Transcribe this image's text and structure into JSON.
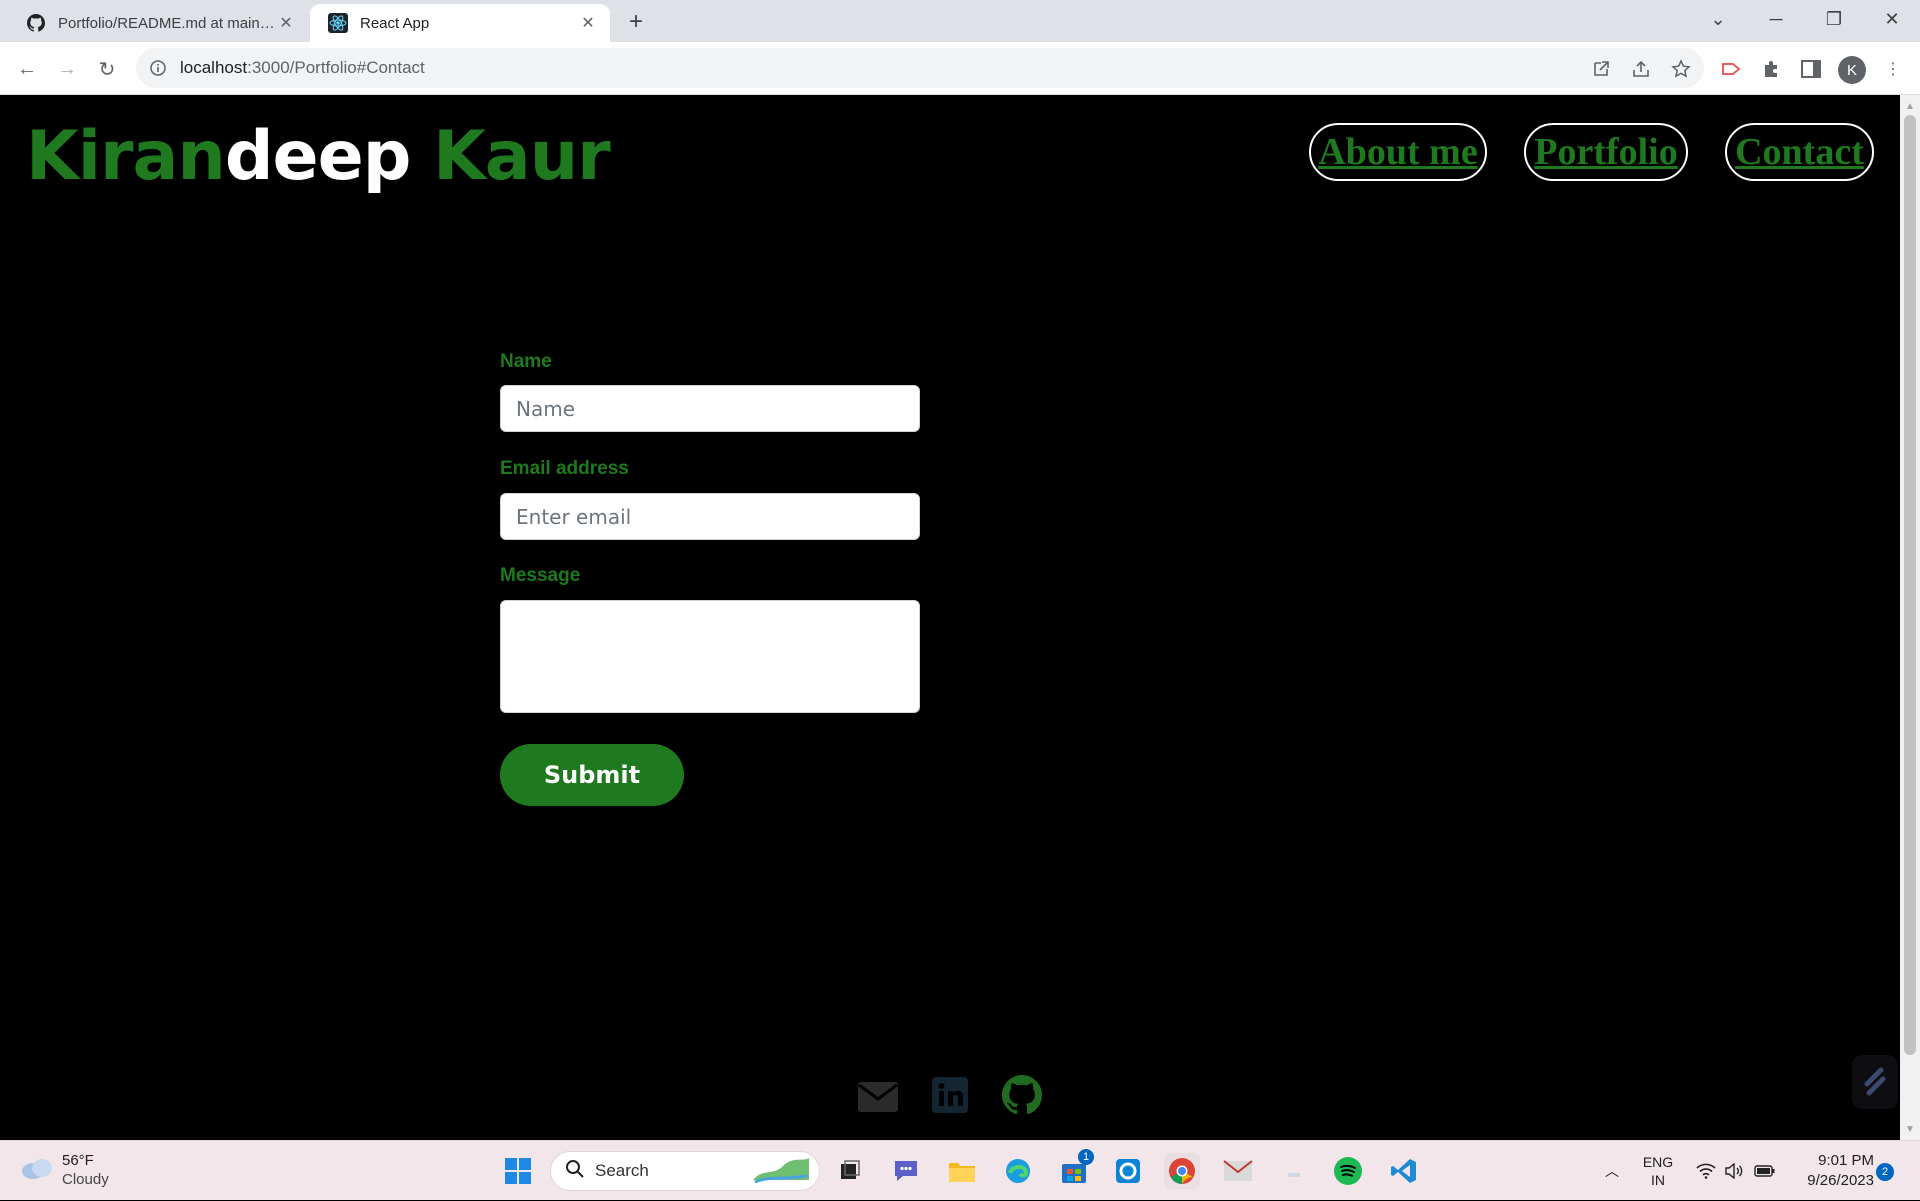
{
  "browser": {
    "tabs": [
      {
        "title": "Portfolio/README.md at main · N",
        "icon": "github-icon",
        "active": false
      },
      {
        "title": "React App",
        "icon": "react-icon",
        "active": true
      }
    ],
    "url_host": "localhost",
    "url_rest": ":3000/Portfolio#Contact",
    "avatar_initial": "K"
  },
  "page": {
    "brand": {
      "part1": "Kiran",
      "part2": "deep",
      "part3": " Kaur"
    },
    "nav": [
      {
        "label": "About me"
      },
      {
        "label": "Portfolio"
      },
      {
        "label": "Contact"
      }
    ],
    "form": {
      "name_label": "Name",
      "name_placeholder": "Name",
      "email_label": "Email address",
      "email_placeholder": "Enter email",
      "message_label": "Message",
      "submit_label": "Submit"
    },
    "social": [
      "envelope-icon",
      "linkedin-icon",
      "github-icon"
    ],
    "colors": {
      "accent": "#1f7a1f",
      "background": "#000000"
    }
  },
  "taskbar": {
    "weather_temp": "56°F",
    "weather_cond": "Cloudy",
    "search_label": "Search",
    "store_badge": "1",
    "lang_top": "ENG",
    "lang_bottom": "IN",
    "time": "9:01 PM",
    "date": "9/26/2023",
    "notification_count": "2"
  }
}
